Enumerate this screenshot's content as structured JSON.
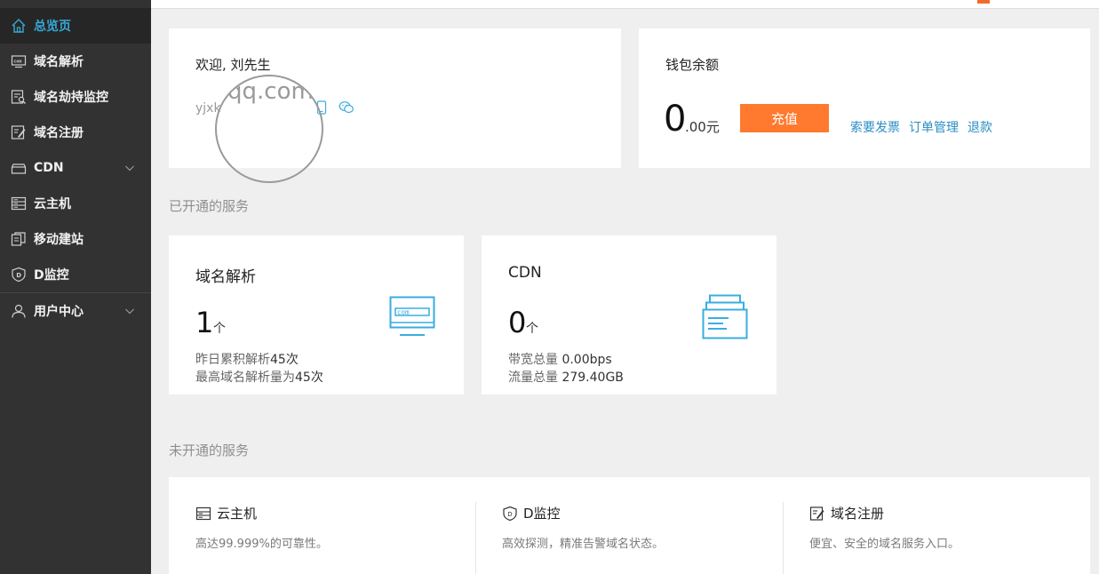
{
  "sidebar": {
    "items": [
      {
        "label": "总览页",
        "icon": "home-icon"
      },
      {
        "label": "域名解析",
        "icon": "com-icon"
      },
      {
        "label": "域名劫持监控",
        "icon": "monitor-search-icon"
      },
      {
        "label": "域名注册",
        "icon": "register-icon"
      },
      {
        "label": "CDN",
        "icon": "box-icon"
      },
      {
        "label": "云主机",
        "icon": "server-icon"
      },
      {
        "label": "移动建站",
        "icon": "mobile-site-icon"
      },
      {
        "label": "D监控",
        "icon": "shield-d-icon"
      },
      {
        "label": "用户中心",
        "icon": "user-icon"
      }
    ]
  },
  "welcome": {
    "title": "欢迎, 刘先生",
    "account": "yjxk",
    "magnified_text": "qq.com"
  },
  "wallet": {
    "title": "钱包余额",
    "balance_integer": "0",
    "balance_fraction": ".00元",
    "recharge_label": "充值",
    "links": [
      "索要发票",
      "订单管理",
      "退款"
    ]
  },
  "sections": {
    "active_title": "已开通的服务",
    "inactive_title": "未开通的服务"
  },
  "active_services": [
    {
      "name": "域名解析",
      "count": "1",
      "unit": "个",
      "line1_label": "昨日累积解析",
      "line1_value": "45次",
      "line2_label": "最高域名解析量为",
      "line2_value": "45次",
      "icon": "com-monitor-illustration"
    },
    {
      "name": "CDN",
      "count": "0",
      "unit": "个",
      "line1_label": "带宽总量 ",
      "line1_value": "0.00bps",
      "line2_label": "流量总量 ",
      "line2_value": "279.40GB",
      "icon": "stacked-docs-illustration"
    }
  ],
  "inactive_services": [
    {
      "name": "云主机",
      "desc": "高达99.999%的可靠性。",
      "icon": "server-icon"
    },
    {
      "name": "D监控",
      "desc": "高效探测，精准告警域名状态。",
      "icon": "shield-d-icon"
    },
    {
      "name": "域名注册",
      "desc": "便宜、安全的域名服务入口。",
      "icon": "register-icon"
    }
  ],
  "colors": {
    "sidebar_bg": "#323232",
    "active_nav": "#37a8d7",
    "accent_orange": "#ff7a2f",
    "link_blue": "#2a8ec4",
    "illustration_blue": "#3aaee0"
  }
}
